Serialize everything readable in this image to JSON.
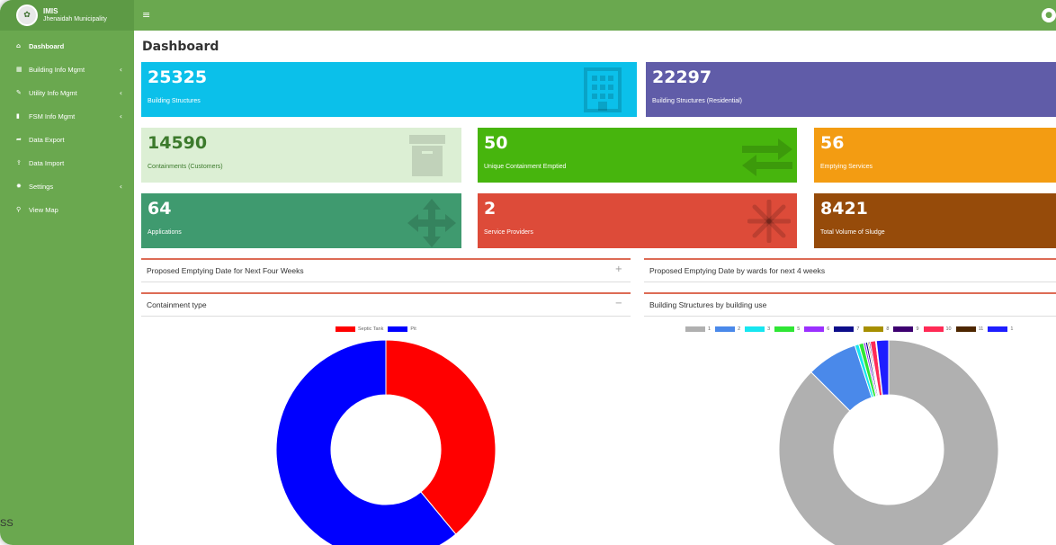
{
  "brand": {
    "title": "IMIS",
    "subtitle": "Jhenaidah Municipality",
    "logo_icon": "municipality-seal-icon"
  },
  "sidebar": {
    "items": [
      {
        "label": "Dashboard",
        "icon": "home-icon",
        "has_arrow": false
      },
      {
        "label": "Building Info Mgmt",
        "icon": "building-icon",
        "has_arrow": true
      },
      {
        "label": "Utility Info Mgmt",
        "icon": "wrench-icon",
        "has_arrow": true
      },
      {
        "label": "FSM Info Mgmt",
        "icon": "file-icon",
        "has_arrow": true
      },
      {
        "label": "Data Export",
        "icon": "share-icon",
        "has_arrow": false
      },
      {
        "label": "Data Import",
        "icon": "upload-icon",
        "has_arrow": false
      },
      {
        "label": "Settings",
        "icon": "gear-icon",
        "has_arrow": true
      },
      {
        "label": "View Map",
        "icon": "map-marker-icon",
        "has_arrow": false
      }
    ]
  },
  "topbar": {
    "menu_icon": "hamburger-icon",
    "user_icon": "user-icon"
  },
  "page": {
    "title": "Dashboard"
  },
  "stats": [
    {
      "value": "25325",
      "label": "Building Structures",
      "color": "#0bc0ea",
      "icon": "building-icon"
    },
    {
      "value": "22297",
      "label": "Building Structures (Residential)",
      "color": "#605ca8",
      "icon": "home-icon"
    },
    {
      "value": "14590",
      "label": "Containments (Customers)",
      "color": "#dcefd4",
      "icon": "archive-box-icon"
    },
    {
      "value": "50",
      "label": "Unique Containment Emptied",
      "color": "#47b50d",
      "icon": "exchange-arrows-icon"
    },
    {
      "value": "56",
      "label": "Emptying Services",
      "color": "#f39c12",
      "icon": "truck-icon"
    },
    {
      "value": "64",
      "label": "Applications",
      "color": "#3f9a6f",
      "icon": "move-arrows-icon"
    },
    {
      "value": "2",
      "label": "Service Providers",
      "color": "#dd4b39",
      "icon": "snowflake-icon"
    },
    {
      "value": "8421",
      "label": "Total Volume of Sludge",
      "color": "#964b0a",
      "icon": "flask-icon"
    }
  ],
  "panels": {
    "proposed_four_weeks": {
      "title": "Proposed Emptying Date for Next Four Weeks",
      "tool": "+"
    },
    "proposed_by_wards": {
      "title": "Proposed Emptying Date by wards for next 4 weeks",
      "tool": ""
    },
    "containment_type": {
      "title": "Containment type",
      "tool": "−"
    },
    "building_use": {
      "title": "Building Structures by building use",
      "tool": ""
    }
  },
  "corner_text": "SS",
  "chart_data": [
    {
      "type": "pie",
      "title": "",
      "categories": [
        "Septic Tank",
        "Pit"
      ],
      "values": [
        39,
        61
      ],
      "colors": [
        "#ff0000",
        "#0000ff"
      ],
      "legend": "top"
    },
    {
      "type": "pie",
      "title": "",
      "categories": [
        "1",
        "2",
        "3",
        "5",
        "6",
        "7",
        "8",
        "9",
        "10",
        "11",
        "1"
      ],
      "values": [
        87.5,
        7.5,
        0.6,
        0.7,
        0.3,
        0.3,
        0.2,
        0.2,
        0.8,
        0.1,
        1.8
      ],
      "colors": [
        "#b0b0b0",
        "#4a89ea",
        "#17e6f0",
        "#2fe635",
        "#9b30ff",
        "#0d0d8a",
        "#a68f00",
        "#3d0070",
        "#ff2a55",
        "#4d2600",
        "#1e1eff"
      ],
      "legend": "top"
    }
  ]
}
